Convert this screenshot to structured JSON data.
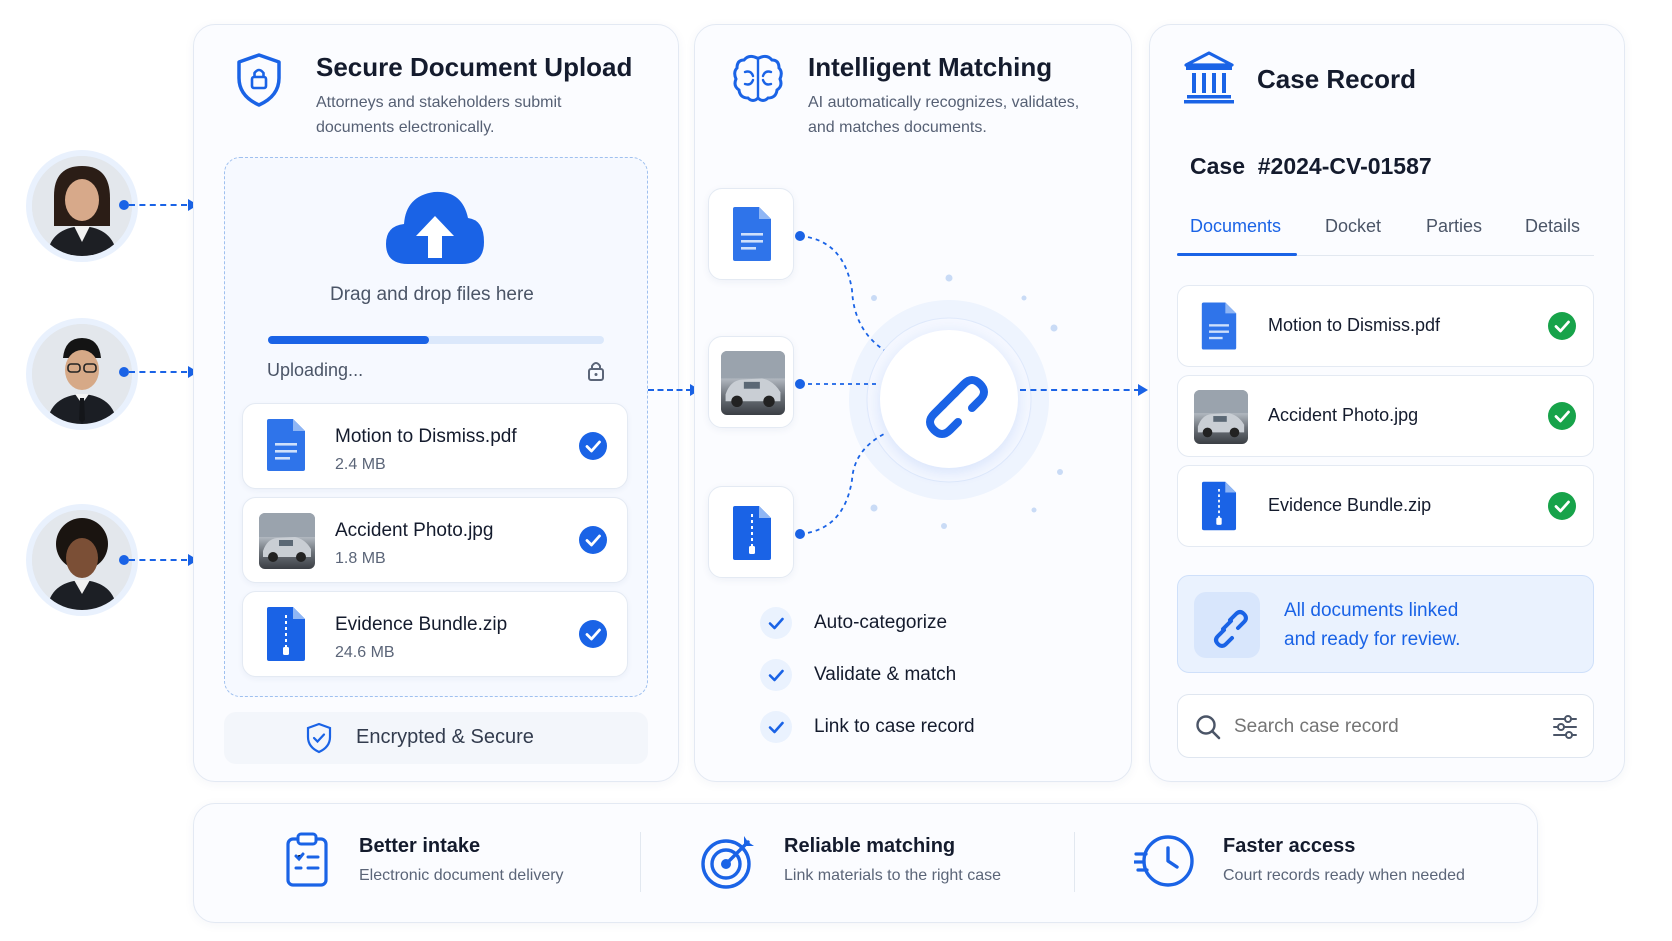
{
  "upload": {
    "title": "Secure Document Upload",
    "subtitle_line1": "Attorneys and stakeholders submit",
    "subtitle_line2": "documents electronically.",
    "drop_label": "Drag and drop files here",
    "status": "Uploading...",
    "progress": 0.48,
    "files": [
      {
        "name": "Motion to Dismiss.pdf",
        "size": "2.4 MB"
      },
      {
        "name": "Accident Photo.jpg",
        "size": "1.8 MB"
      },
      {
        "name": "Evidence Bundle.zip",
        "size": "24.6 MB"
      }
    ],
    "footer": "Encrypted & Secure"
  },
  "matching": {
    "title": "Intelligent Matching",
    "subtitle_line1": "AI automatically recognizes, validates,",
    "subtitle_line2": "and matches documents.",
    "steps": [
      "Auto-categorize",
      "Validate & match",
      "Link to case record"
    ]
  },
  "case": {
    "title": "Case Record",
    "number": "Case  #2024-CV-01587",
    "tabs": [
      "Documents",
      "Docket",
      "Parties",
      "Details"
    ],
    "active_tab": "Documents",
    "documents": [
      "Motion to Dismiss.pdf",
      "Accident Photo.jpg",
      "Evidence Bundle.zip"
    ],
    "banner_line1": "All documents linked",
    "banner_line2": "and ready for review.",
    "search_placeholder": "Search case record"
  },
  "benefits": [
    {
      "title": "Better intake",
      "subtitle": "Electronic document delivery",
      "icon": "clipboard-icon"
    },
    {
      "title": "Reliable matching",
      "subtitle": "Link materials to the right case",
      "icon": "target-icon"
    },
    {
      "title": "Faster access",
      "subtitle": "Court records ready when needed",
      "icon": "clock-icon"
    }
  ],
  "colors": {
    "accent": "#1a63e6",
    "success": "#17a34a",
    "text": "#141b2d"
  }
}
